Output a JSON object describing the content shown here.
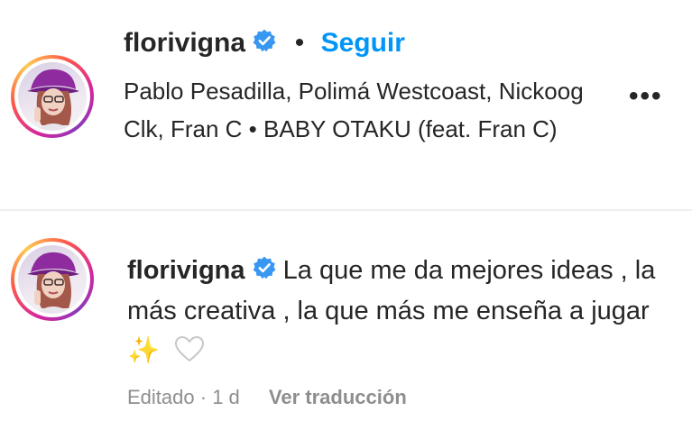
{
  "post": {
    "username": "florivigna",
    "separator": "•",
    "follow_label": "Seguir",
    "audio_line": "Pablo Pesadilla, Polimá Westcoast, Nickoog Clk, Fran C • BABY OTAKU (feat. Fran C)",
    "more_label": "•••"
  },
  "comment": {
    "username": "florivigna",
    "text": "La que me da mejores ideas , la más creativa , la que más me enseña a jugar",
    "emoji": "✨",
    "edited_label": "Editado",
    "time_separator": "·",
    "time": "1 d",
    "translate_label": "Ver traducción"
  },
  "colors": {
    "accent": "#0095f6",
    "verified": "#3897f0",
    "muted": "#8e8e8e",
    "text": "#262626"
  },
  "icons": {
    "verified": "verified-badge-icon",
    "more": "more-options-icon",
    "heart": "heart-outline-icon"
  }
}
